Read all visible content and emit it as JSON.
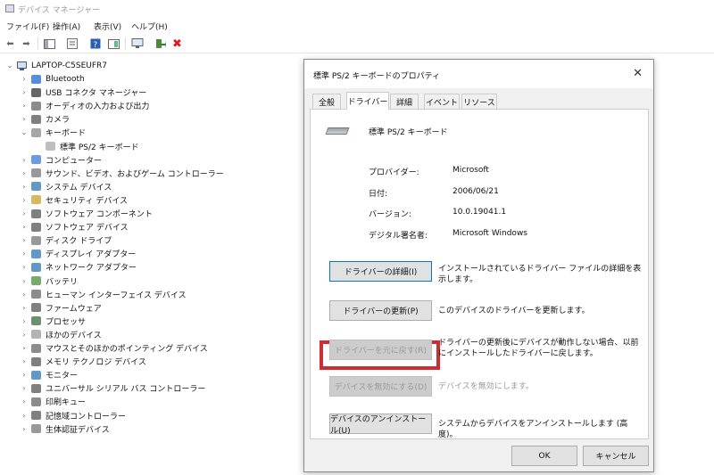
{
  "window": {
    "title": "デバイス マネージャー"
  },
  "menu": [
    "ファイル(F)",
    "操作(A)",
    "表示(V)",
    "ヘルプ(H)"
  ],
  "tree": {
    "root": "LAPTOP-C5SEUFR7",
    "items": [
      "Bluetooth",
      "USB コネクタ マネージャー",
      "オーディオの入力および出力",
      "カメラ",
      "キーボード",
      "標準 PS/2 キーボード",
      "コンピューター",
      "サウンド、ビデオ、およびゲーム コントローラー",
      "システム デバイス",
      "セキュリティ デバイス",
      "ソフトウェア コンポーネント",
      "ソフトウェア デバイス",
      "ディスク ドライブ",
      "ディスプレイ アダプター",
      "ネットワーク アダプター",
      "バッテリ",
      "ヒューマン インターフェイス デバイス",
      "ファームウェア",
      "プロセッサ",
      "ほかのデバイス",
      "マウスとそのほかのポインティング デバイス",
      "メモリ テクノロジ デバイス",
      "モニター",
      "ユニバーサル シリアル バス コントローラー",
      "印刷キュー",
      "記憶域コントローラー",
      "生体認証デバイス"
    ]
  },
  "dialog": {
    "title": "標準 PS/2 キーボードのプロパティ",
    "tabs": [
      "全般",
      "ドライバー",
      "詳細",
      "イベント",
      "リソース"
    ],
    "device_name": "標準 PS/2 キーボード",
    "props": [
      {
        "label": "プロバイダー:",
        "value": "Microsoft"
      },
      {
        "label": "日付:",
        "value": "2006/06/21"
      },
      {
        "label": "バージョン:",
        "value": "10.0.19041.1"
      },
      {
        "label": "デジタル署名者:",
        "value": "Microsoft Windows"
      }
    ],
    "buttons": [
      {
        "label": "ドライバーの詳細(I)",
        "desc": "インストールされているドライバー ファイルの詳細を表示します。"
      },
      {
        "label": "ドライバーの更新(P)",
        "desc": "このデバイスのドライバーを更新します。"
      },
      {
        "label": "ドライバーを元に戻す(R)",
        "desc": "ドライバーの更新後にデバイスが動作しない場合、以前にインストールしたドライバーに戻します。"
      },
      {
        "label": "デバイスを無効にする(D)",
        "desc": "デバイスを無効にします。"
      },
      {
        "label": "デバイスのアンインストール(U)",
        "desc": "システムからデバイスをアンインストールします (高度)。"
      }
    ],
    "ok": "OK",
    "cancel": "キャンセル"
  },
  "colors": {
    "highlight": "#cf2d34",
    "accent": "#0078d7"
  }
}
